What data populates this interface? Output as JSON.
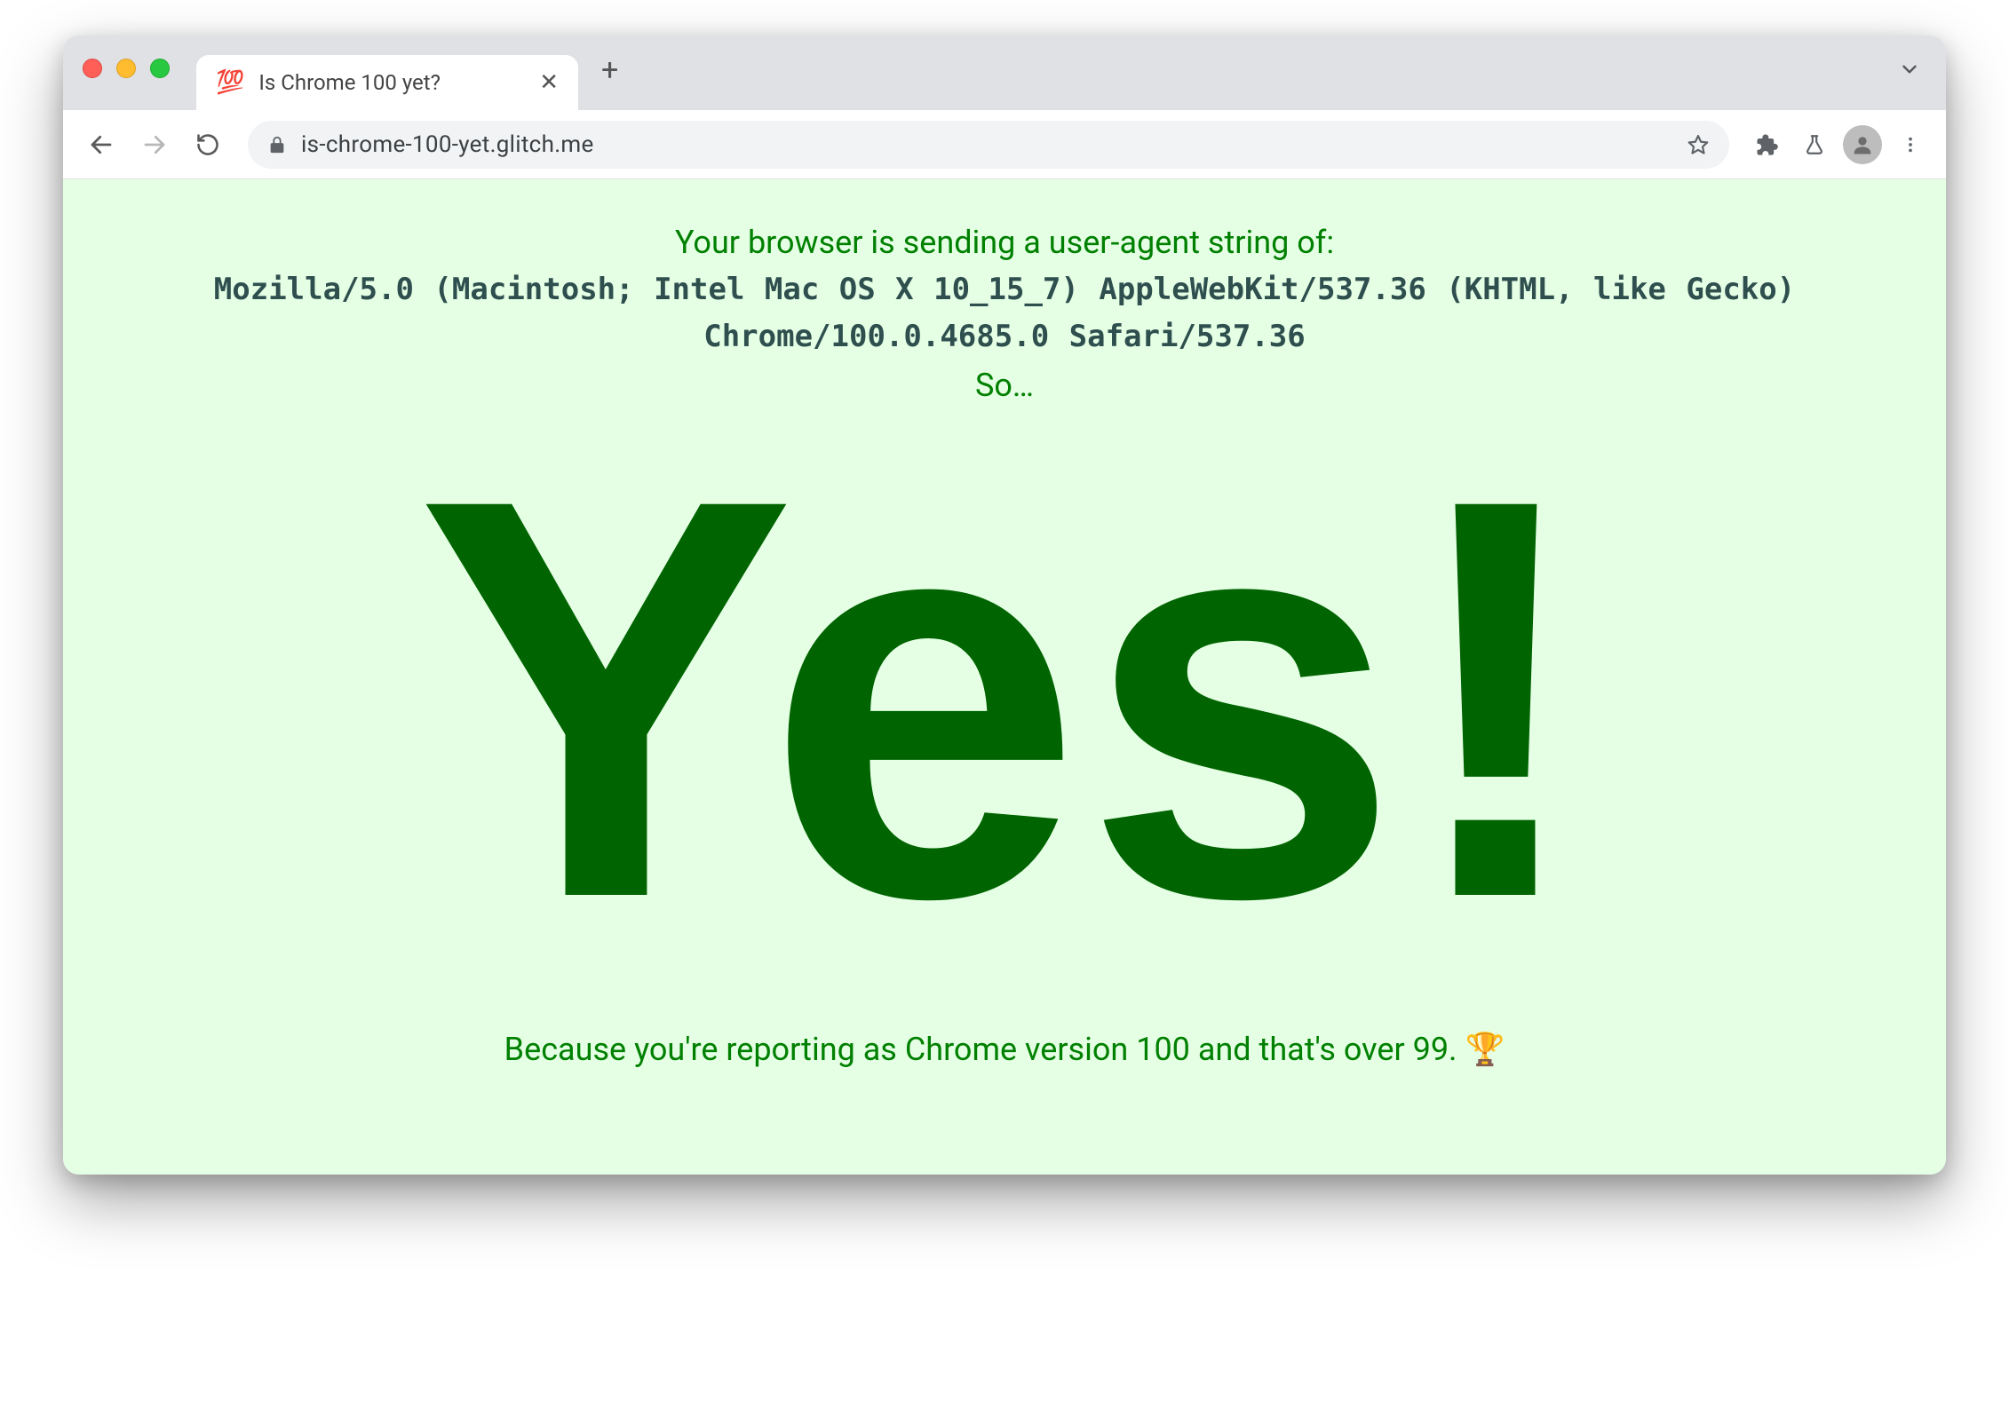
{
  "browser": {
    "tab": {
      "favicon": "💯",
      "title": "Is Chrome 100 yet?"
    },
    "address_url": "is-chrome-100-yet.glitch.me"
  },
  "page": {
    "intro": "Your browser is sending a user-agent string of:",
    "ua": "Mozilla/5.0 (Macintosh; Intel Mac OS X 10_15_7) AppleWebKit/537.36 (KHTML, like Gecko) Chrome/100.0.4685.0 Safari/537.36",
    "so": "So…",
    "answer": "Yes!",
    "because": "Because you're reporting as Chrome version 100 and that's over 99. 🏆"
  }
}
